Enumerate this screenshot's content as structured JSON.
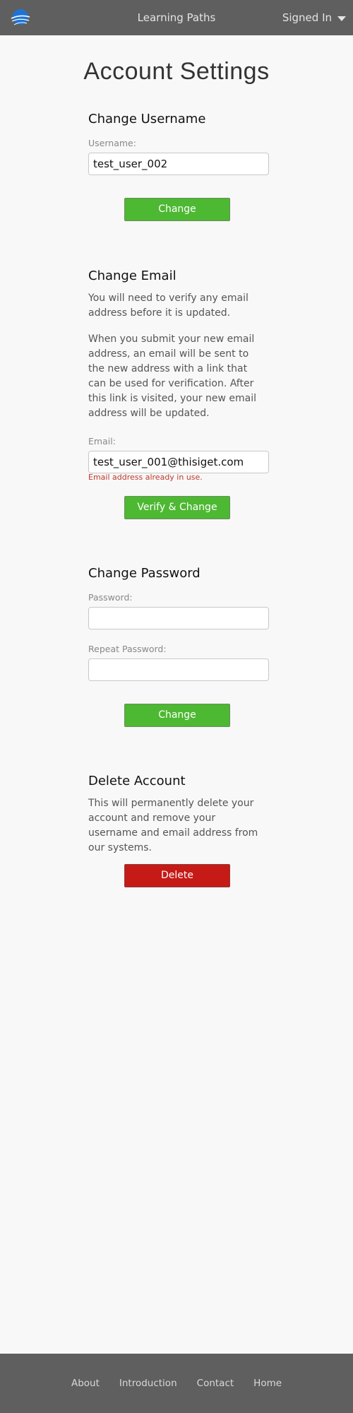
{
  "header": {
    "title": "Learning Paths",
    "account_label": "Signed In",
    "logo_icon": "globe-logo-icon"
  },
  "page": {
    "title": "Account Settings"
  },
  "username_section": {
    "title": "Change Username",
    "field_label": "Username:",
    "value": "test_user_002",
    "button_label": "Change"
  },
  "email_section": {
    "title": "Change Email",
    "para1": "You will need to verify any email address before it is updated.",
    "para2": "When you submit your new email address, an email will be sent to the new address with a link that can be used for verification. After this link is visited, your new email address will be updated.",
    "field_label": "Email:",
    "value": "test_user_001@thisiget.com",
    "error": "Email address already in use.",
    "button_label": "Verify & Change"
  },
  "password_section": {
    "title": "Change Password",
    "password_label": "Password:",
    "password_value": "",
    "repeat_label": "Repeat Password:",
    "repeat_value": "",
    "button_label": "Change"
  },
  "delete_section": {
    "title": "Delete Account",
    "para": "This will permanently delete your account and remove your username and email address from our systems.",
    "button_label": "Delete"
  },
  "footer": {
    "links": [
      "About",
      "Introduction",
      "Contact",
      "Home"
    ]
  },
  "colors": {
    "header_bg": "#5f5f5f",
    "page_bg": "#f8f8f8",
    "primary_button": "#4db832",
    "danger_button": "#c51a16",
    "error_text": "#c0392b"
  }
}
